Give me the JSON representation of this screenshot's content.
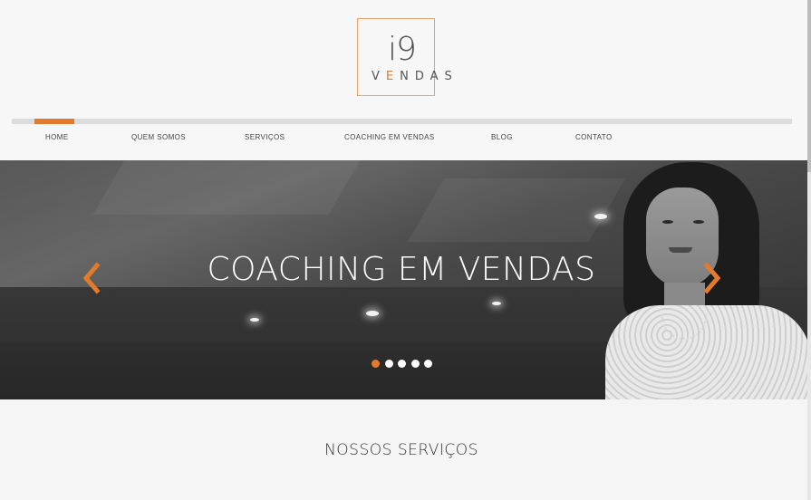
{
  "logo": {
    "mark": "i9",
    "word_before": "V",
    "word_accent": "E",
    "word_after": "NDAS"
  },
  "nav": {
    "items": [
      {
        "label": "HOME",
        "active": true
      },
      {
        "label": "QUEM SOMOS"
      },
      {
        "label": "SERVIÇOS"
      },
      {
        "label": "COACHING EM VENDAS"
      },
      {
        "label": "BLOG"
      },
      {
        "label": "CONTATO"
      }
    ]
  },
  "hero": {
    "title": "COACHING EM VENDAS",
    "prev_icon": "chevron-left-icon",
    "next_icon": "chevron-right-icon",
    "slide_count": 5,
    "active_slide": 1
  },
  "section": {
    "title": "NOSSOS SERVIÇOS"
  },
  "colors": {
    "accent": "#e47b2c",
    "nav_bar": "#dcdcdc",
    "header_bg": "#f7f7f8",
    "page_bg": "#f5f5f5"
  }
}
